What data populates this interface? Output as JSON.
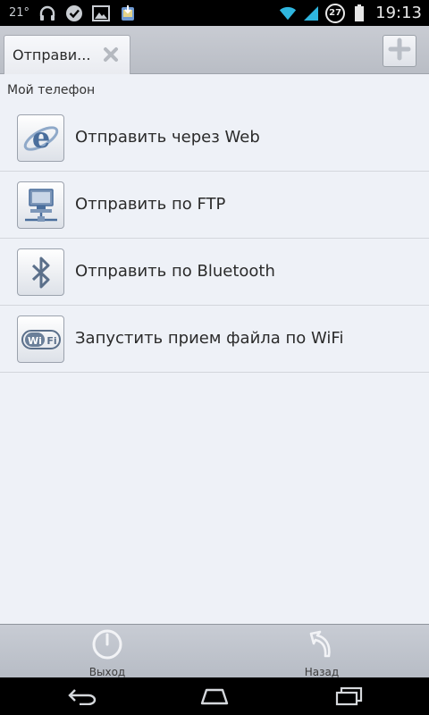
{
  "statusbar": {
    "temperature": "21°",
    "battery_badge": "27",
    "time": "19:13",
    "icons": [
      "headphones-icon",
      "check-icon",
      "image-icon",
      "download-icon",
      "wifi-icon",
      "signal-icon",
      "battery-icon"
    ]
  },
  "tabbar": {
    "tab_label": "Отправи...",
    "add_icon": "plus-icon",
    "close_icon": "close-icon"
  },
  "content": {
    "section_header": "Мой телефон",
    "items": [
      {
        "label": "Отправить через Web",
        "icon": "internet-explorer-icon"
      },
      {
        "label": "Отправить по FTP",
        "icon": "network-computer-icon"
      },
      {
        "label": "Отправить по Bluetooth",
        "icon": "bluetooth-icon"
      },
      {
        "label": "Запустить прием файла по WiFi",
        "icon": "wifi-logo-icon"
      }
    ]
  },
  "actionbar": {
    "exit_label": "Выход",
    "back_label": "Назад"
  },
  "colors": {
    "background": "#eef1f7",
    "bar": "#c0c4cc",
    "icon_blue": "#4a6e9c"
  }
}
